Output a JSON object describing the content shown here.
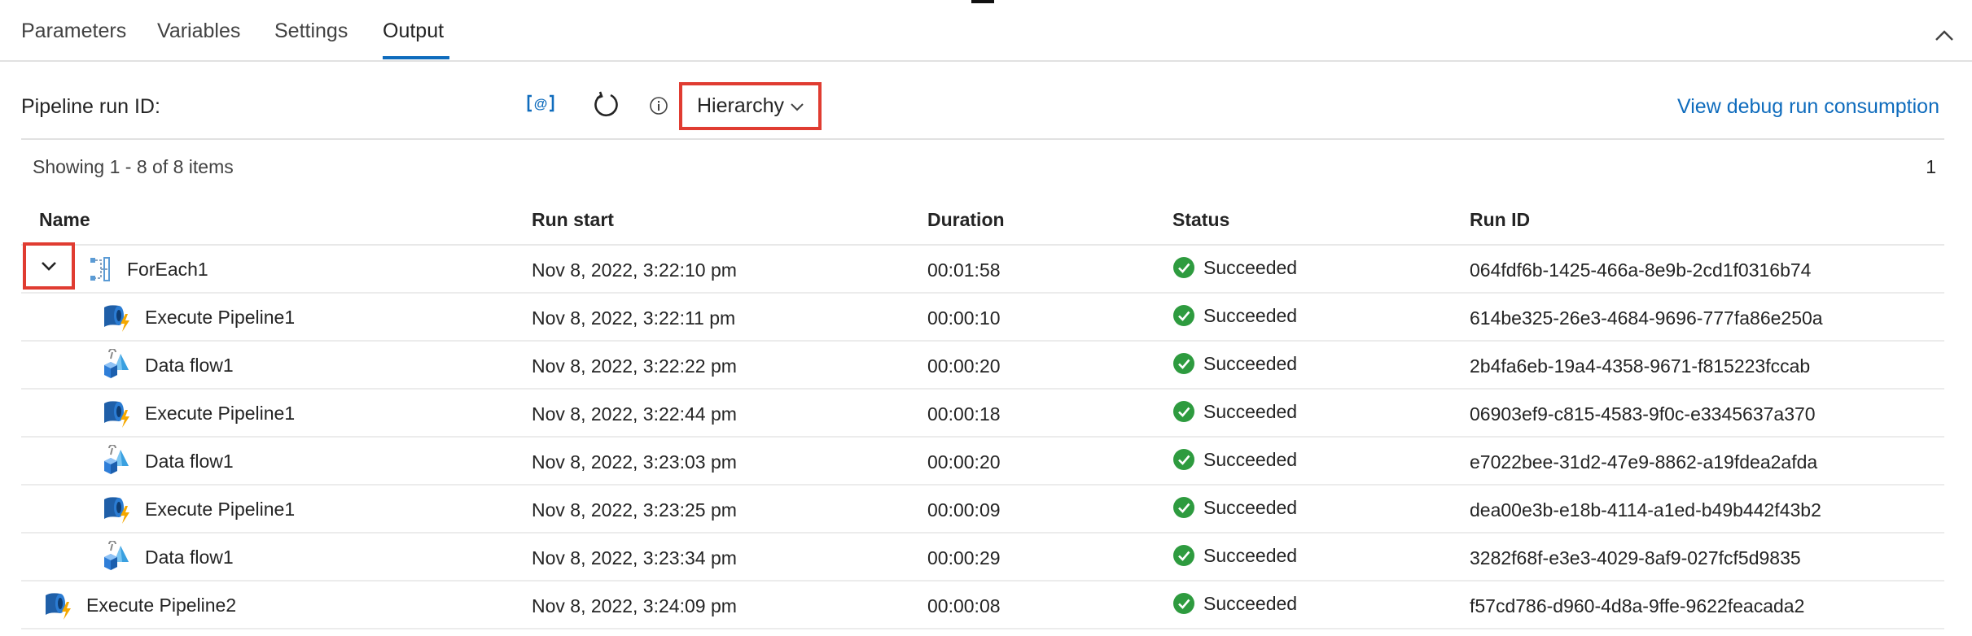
{
  "tabs": [
    {
      "label": "Parameters"
    },
    {
      "label": "Variables"
    },
    {
      "label": "Settings"
    },
    {
      "label": "Output",
      "active": true
    }
  ],
  "toolbar": {
    "run_id_label": "Pipeline run ID:",
    "icons": [
      "copy-run-id-icon",
      "refresh-icon",
      "info-icon"
    ],
    "view_select": "Hierarchy",
    "debug_link": "View debug run consumption"
  },
  "pagination": {
    "showing": "Showing 1 - 8 of 8 items",
    "page": "1"
  },
  "table": {
    "columns": [
      "Name",
      "Run start",
      "Duration",
      "Status",
      "Run ID"
    ],
    "rows": [
      {
        "name": "ForEach1",
        "type": "foreach",
        "level": 0,
        "run_start": "Nov 8, 2022, 3:22:10 pm",
        "duration": "00:01:58",
        "status": "Succeeded",
        "run_id": "064fdf6b-1425-466a-8e9b-2cd1f0316b74"
      },
      {
        "name": "Execute Pipeline1",
        "type": "execute-pipeline",
        "level": 1,
        "run_start": "Nov 8, 2022, 3:22:11 pm",
        "duration": "00:00:10",
        "status": "Succeeded",
        "run_id": "614be325-26e3-4684-9696-777fa86e250a"
      },
      {
        "name": "Data flow1",
        "type": "data-flow",
        "level": 1,
        "run_start": "Nov 8, 2022, 3:22:22 pm",
        "duration": "00:00:20",
        "status": "Succeeded",
        "run_id": "2b4fa6eb-19a4-4358-9671-f815223fccab"
      },
      {
        "name": "Execute Pipeline1",
        "type": "execute-pipeline",
        "level": 1,
        "run_start": "Nov 8, 2022, 3:22:44 pm",
        "duration": "00:00:18",
        "status": "Succeeded",
        "run_id": "06903ef9-c815-4583-9f0c-e3345637a370"
      },
      {
        "name": "Data flow1",
        "type": "data-flow",
        "level": 1,
        "run_start": "Nov 8, 2022, 3:23:03 pm",
        "duration": "00:00:20",
        "status": "Succeeded",
        "run_id": "e7022bee-31d2-47e9-8862-a19fdea2afda"
      },
      {
        "name": "Execute Pipeline1",
        "type": "execute-pipeline",
        "level": 1,
        "run_start": "Nov 8, 2022, 3:23:25 pm",
        "duration": "00:00:09",
        "status": "Succeeded",
        "run_id": "dea00e3b-e18b-4114-a1ed-b49b442f43b2"
      },
      {
        "name": "Data flow1",
        "type": "data-flow",
        "level": 1,
        "run_start": "Nov 8, 2022, 3:23:34 pm",
        "duration": "00:00:29",
        "status": "Succeeded",
        "run_id": "3282f68f-e3e3-4029-8af9-027fcf5d9835"
      },
      {
        "name": "Execute Pipeline2",
        "type": "execute-pipeline",
        "level": 0,
        "run_start": "Nov 8, 2022, 3:24:09 pm",
        "duration": "00:00:08",
        "status": "Succeeded",
        "run_id": "f57cd786-d960-4d8a-9ffe-9622feacada2"
      }
    ]
  },
  "colors": {
    "accent": "#0f6cbd",
    "highlight_border": "#e03c31",
    "success": "#2e9b3f"
  }
}
